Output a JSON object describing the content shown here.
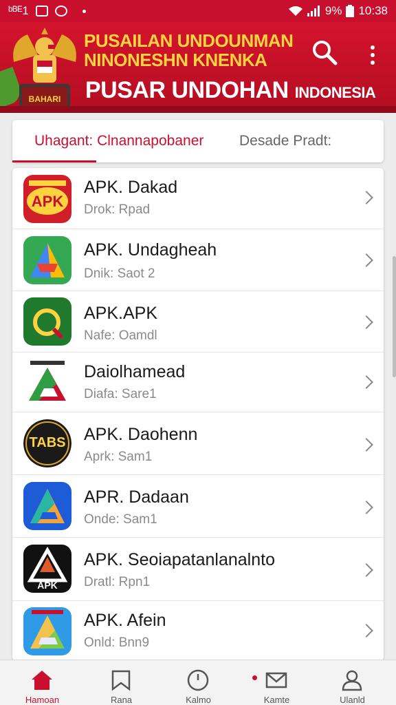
{
  "status_bar": {
    "left_text": "ᵇᴮᴱ1",
    "signal": "ᵇ᷊",
    "battery_percent": "9%",
    "time": "10:38"
  },
  "header": {
    "title_line1": "PUSAILAN UNDOUNMAN",
    "title_line2": "NINONESHN KNENKA",
    "title_main": "PUSAR UNDOHAN",
    "title_main_small": "INDONESIA",
    "emblem_text": "BAHARI",
    "colors": {
      "primary": "#c8102e",
      "gold": "#ffd23f"
    }
  },
  "tabs": {
    "active": "Uhagant: Clnannapobaner",
    "inactive": "Desade Pradt:"
  },
  "apps": [
    {
      "name": "APK. Dakad",
      "sub": "Drok: Rpad",
      "icon": "apk-badge-icon"
    },
    {
      "name": "APK. Undagheah",
      "sub": "Dnik: Saot 2",
      "icon": "maps-a-icon"
    },
    {
      "name": "APK.APK",
      "sub": "Nafe: Oamdl",
      "icon": "search-q-icon"
    },
    {
      "name": "Daiolhamead",
      "sub": "Diafa: Sare1",
      "icon": "triangle-a-icon"
    },
    {
      "name": "APK. Daohenn",
      "sub": "Aprk: Sam1",
      "icon": "tabs-badge-icon",
      "icon_text": "TABS"
    },
    {
      "name": "APR. Dadaan",
      "sub": "Onde: Sam1",
      "icon": "blue-a-icon"
    },
    {
      "name": "APK. Seoiapatanlanalnto",
      "sub": "Dratl: Rpn1",
      "icon": "black-apk-icon",
      "icon_text": "APK"
    },
    {
      "name": "APK. Afein",
      "sub": "Onld: Bnn9",
      "icon": "sky-a-icon"
    }
  ],
  "bottom_nav": [
    {
      "label": "Hamoan",
      "icon": "home-icon",
      "active": true
    },
    {
      "label": "Rana",
      "icon": "bookmark-icon",
      "active": false
    },
    {
      "label": "Kalmo",
      "icon": "clock-icon",
      "active": false
    },
    {
      "label": "Kamte",
      "icon": "mail-icon",
      "active": false
    },
    {
      "label": "Ulanld",
      "icon": "user-icon",
      "active": false
    }
  ]
}
